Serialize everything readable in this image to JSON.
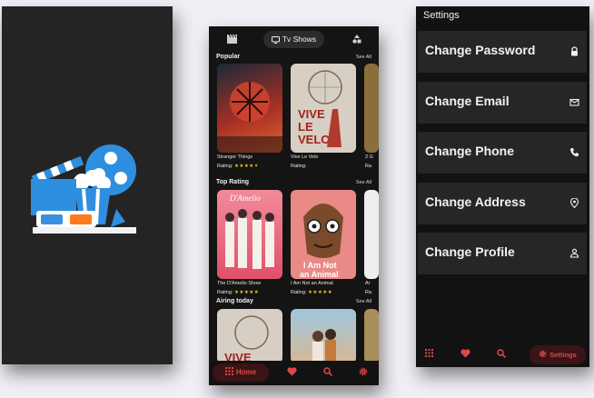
{
  "tv": {
    "top_tab_label": "Tv Shows",
    "icons": [
      "clapperboard-icon",
      "tv-icon",
      "shapes-icon"
    ],
    "sections": [
      {
        "title": "Popular",
        "see_all": "See All",
        "items": [
          {
            "name": "Stranger Things",
            "rating_label": "Rating:",
            "stars": "★★★★✦",
            "color": "#b8362a"
          },
          {
            "name": "Vive Le Velo",
            "rating_label": "Rating:",
            "stars": "",
            "color": "#d7cfc3"
          },
          {
            "name": "2 G",
            "rating_label": "Ra",
            "stars": "",
            "color": "#8a6f3a"
          }
        ]
      },
      {
        "title": "Top Rating",
        "see_all": "See All",
        "items": [
          {
            "name": "The D'Amelio Show",
            "rating_label": "Rating:",
            "stars": "★★★★★",
            "color": "#e45a6c"
          },
          {
            "name": "I Am Not an Animal",
            "rating_label": "Rating:",
            "stars": "★★★★★",
            "color": "#e98a86"
          },
          {
            "name": "Ar",
            "rating_label": "Ra",
            "stars": "",
            "color": "#eeeeee"
          }
        ]
      },
      {
        "title": "Airing today",
        "see_all": "See All",
        "items": [
          {
            "name": "",
            "rating_label": "",
            "stars": "",
            "color": "#d7cfc3"
          },
          {
            "name": "",
            "rating_label": "",
            "stars": "",
            "color": "#7fb3d5"
          },
          {
            "name": "",
            "rating_label": "",
            "stars": "",
            "color": "#a88f5a"
          }
        ]
      }
    ],
    "posters_text": {
      "vive_title": "VIVE\nLE\nVELO",
      "damelio_title": "D'Amelio",
      "animal_title": "I Am Not\nan Animal"
    },
    "nav": {
      "home_label": "Home",
      "icons": [
        "grid-icon",
        "heart-icon",
        "search-icon",
        "gear-icon"
      ]
    }
  },
  "settings": {
    "title": "Settings",
    "rows": [
      {
        "label": "Change Password",
        "icon": "lock-icon"
      },
      {
        "label": "Change Email",
        "icon": "mail-icon"
      },
      {
        "label": "Change Phone",
        "icon": "phone-icon"
      },
      {
        "label": "Change Address",
        "icon": "location-icon"
      },
      {
        "label": "Change Profile",
        "icon": "person-icon"
      }
    ],
    "nav": {
      "settings_label": "Settings",
      "icons": [
        "grid-icon",
        "heart-icon",
        "search-icon",
        "gear-icon"
      ]
    }
  },
  "colors": {
    "accent": "#e04848",
    "star": "#f5c518",
    "logo_blue": "#2e8fe0"
  }
}
